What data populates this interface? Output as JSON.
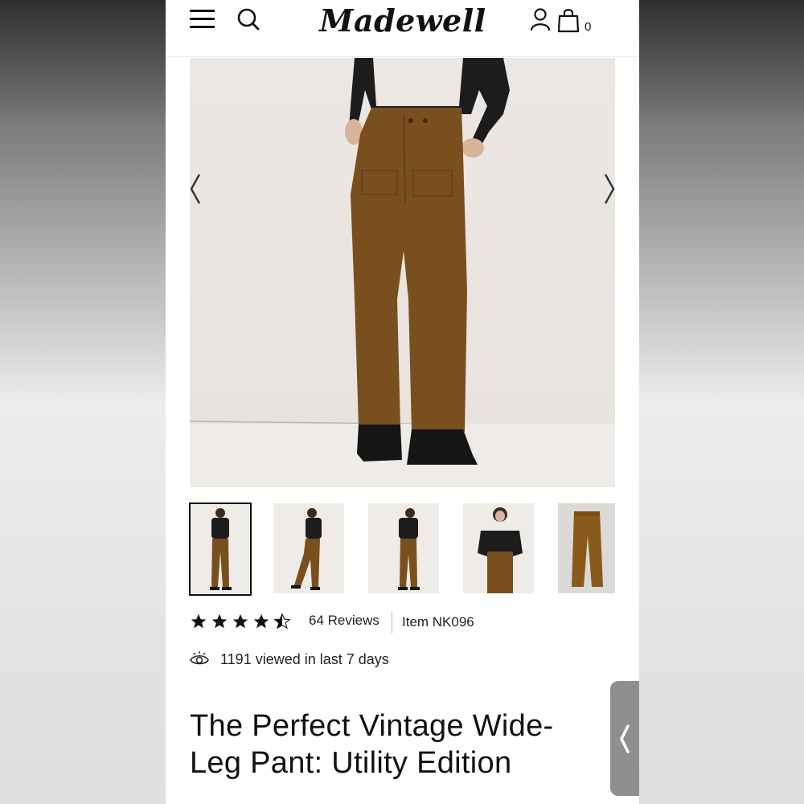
{
  "header": {
    "logo": "Madewell",
    "bag_count": "0",
    "icons": [
      "hamburger-menu-icon",
      "search-icon",
      "user-icon",
      "shopping-bag-icon"
    ]
  },
  "gallery": {
    "thumbnail_count": 5,
    "active_index": 0,
    "icons": [
      "chevron-left-icon",
      "chevron-right-icon"
    ]
  },
  "product": {
    "rating": 4.5,
    "rating_max": 5,
    "reviews": "64 Reviews",
    "item_number": "Item NK096",
    "views": "1191 viewed in last 7 days",
    "title": "The Perfect Vintage Wide-Leg Pant: Utility Edition"
  },
  "colors": {
    "pant": "#7a4f1e",
    "top": "#1c1c1c",
    "backdrop": "#ebe6e1",
    "side_tab": "#8f8f8f"
  }
}
